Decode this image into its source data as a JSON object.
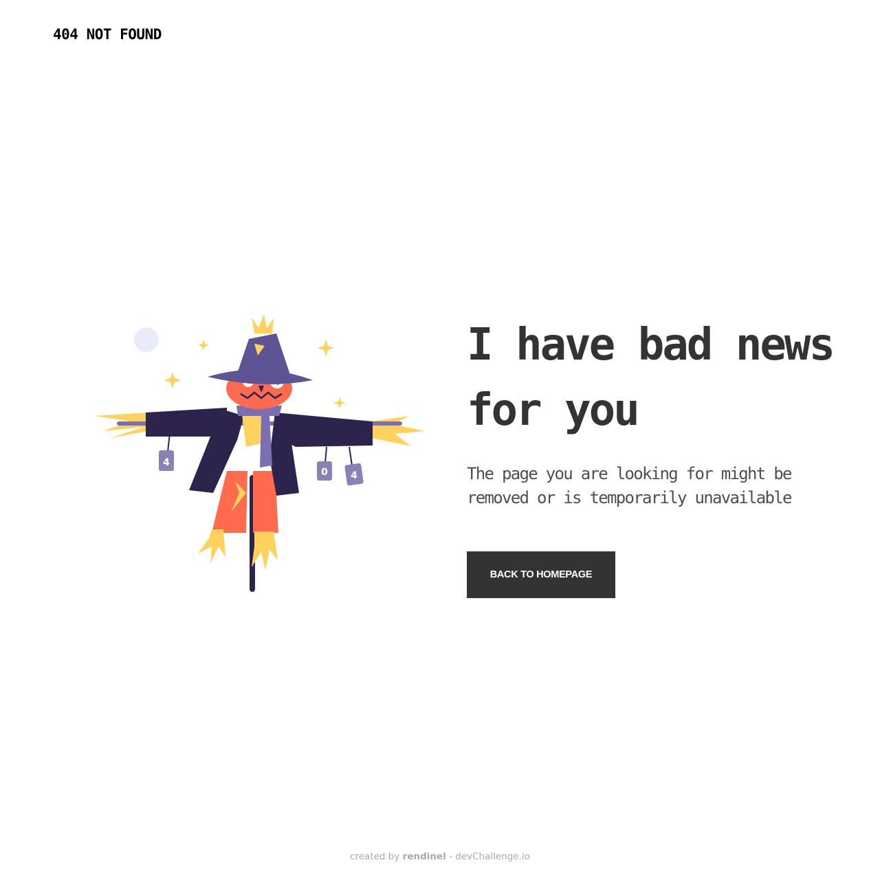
{
  "header": {
    "brand_text": "404 NOT FOUND"
  },
  "illustration": {
    "can_labels": [
      "4",
      "0",
      "4"
    ],
    "colors": {
      "hat": "#5e5393",
      "jacket": "#2c244d",
      "pumpkin": "#ff6b4f",
      "straw": "#ffd25f",
      "scarf": "#7b6fb2",
      "cans": "#8a82b4",
      "moon": "#e9ecf8",
      "stars": "#ffd25f"
    }
  },
  "main": {
    "headline_lines": [
      "I have bad news",
      "for you"
    ],
    "message_lines": [
      "The page you are looking for might be",
      "removed or is temporarily unavailable"
    ],
    "button_label": "BACK TO HOMEPAGE"
  },
  "footer": {
    "prefix": "created by ",
    "author": "rendinel",
    "suffix": " - devChallenge.io"
  },
  "colors": {
    "text_dark": "#333333",
    "text_body": "#4f4f4f",
    "button_bg": "#333333",
    "button_text": "#ffffff",
    "footer_text": "#a9a9a9"
  }
}
